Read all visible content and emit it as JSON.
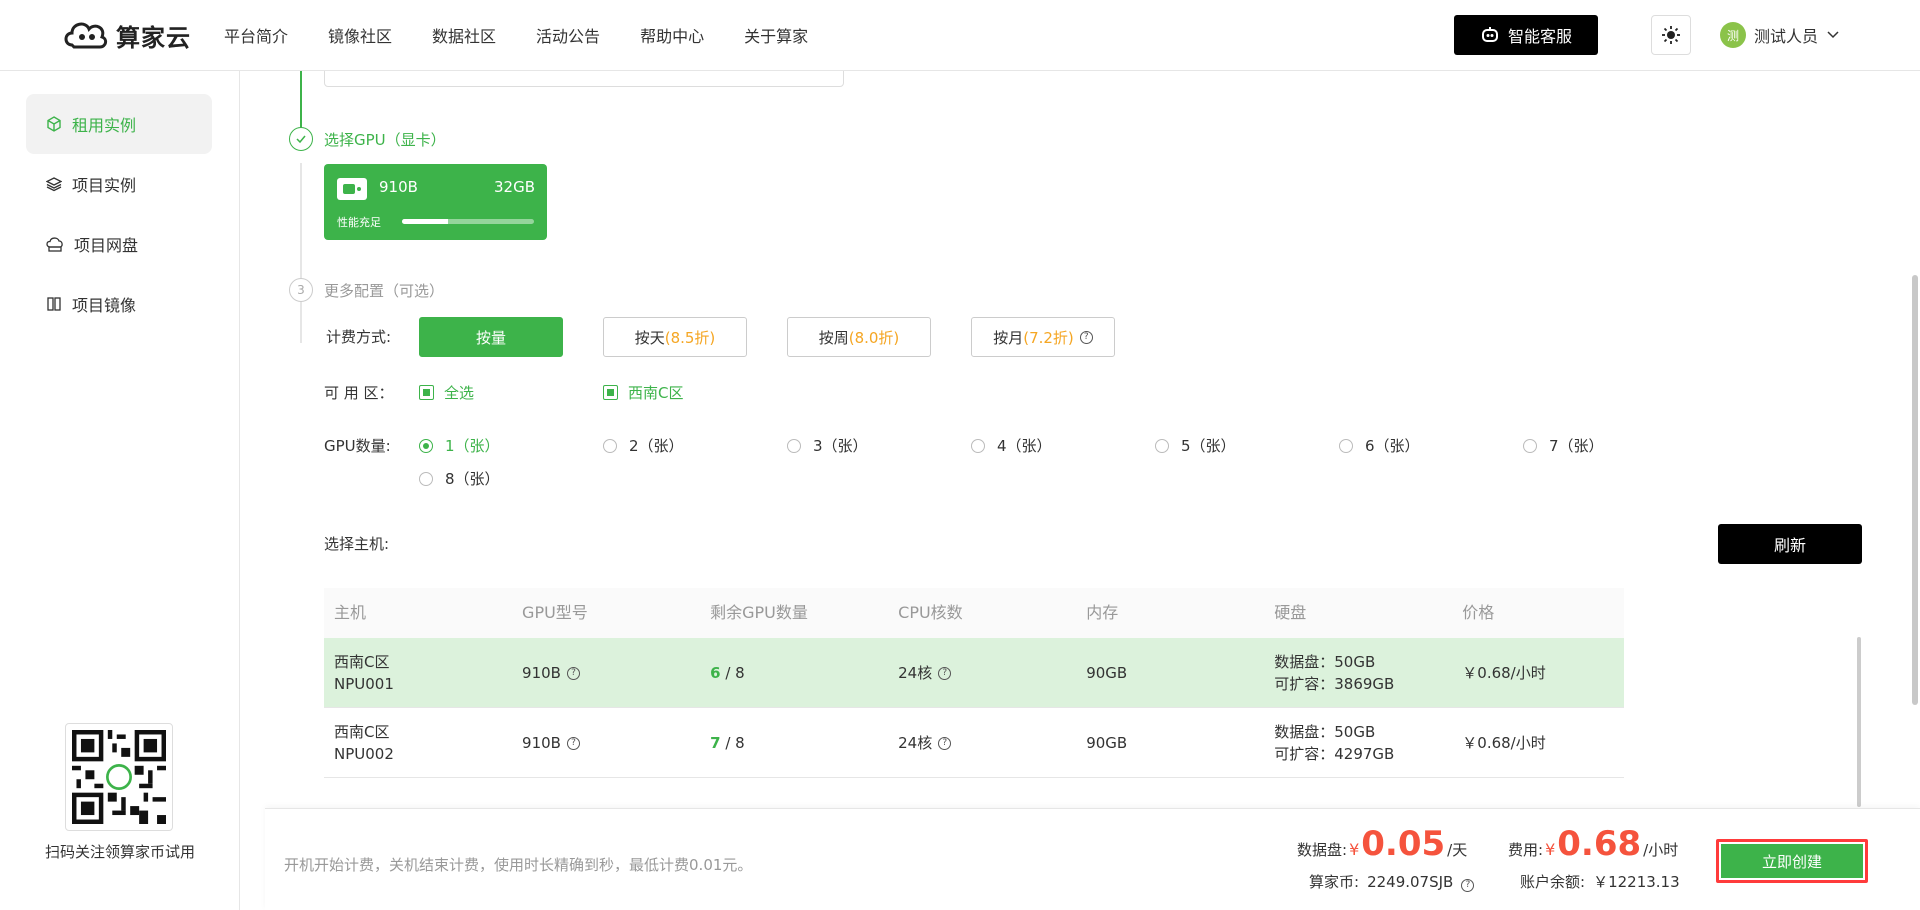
{
  "header": {
    "logo_text": "算家云",
    "nav": [
      "平台简介",
      "镜像社区",
      "数据社区",
      "活动公告",
      "帮助中心",
      "关于算家"
    ],
    "support_label": "智能客服",
    "user_avatar": "测",
    "user_name": "测试人员"
  },
  "sidebar": {
    "items": [
      {
        "label": "租用实例",
        "icon": "cube-icon"
      },
      {
        "label": "项目实例",
        "icon": "layers-icon"
      },
      {
        "label": "项目网盘",
        "icon": "cloud-disk-icon"
      },
      {
        "label": "项目镜像",
        "icon": "image-icon"
      }
    ],
    "qr_caption": "扫码关注领算家币试用"
  },
  "steps": {
    "gpu_title": "选择GPU（显卡）",
    "more_number": "3",
    "more_title": "更多配置（可选）"
  },
  "gpu_card": {
    "model": "910B",
    "memory": "32GB",
    "perf_label": "性能充足",
    "perf_fraction": 0.35
  },
  "billing": {
    "label": "计费方式:",
    "options": [
      {
        "main": "按量",
        "discount": ""
      },
      {
        "main": "按天",
        "discount": "(8.5折)"
      },
      {
        "main": "按周",
        "discount": "(8.0折)"
      },
      {
        "main": "按月",
        "discount": "(7.2折)"
      }
    ]
  },
  "zone": {
    "label": "可 用 区：",
    "options": [
      "全选",
      "西南C区"
    ]
  },
  "gpu_count": {
    "label": "GPU数量:",
    "options": [
      "1（张）",
      "2（张）",
      "3（张）",
      "4（张）",
      "5（张）",
      "6（张）",
      "7（张）",
      "8（张）"
    ],
    "selected": 0
  },
  "host": {
    "label": "选择主机:",
    "refresh_label": "刷新"
  },
  "table": {
    "headers": [
      "主机",
      "GPU型号",
      "剩余GPU数量",
      "CPU核数",
      "内存",
      "硬盘",
      "价格"
    ],
    "rows": [
      {
        "zone": "西南C区",
        "name": "NPU001",
        "gpu": "910B",
        "free": "6",
        "total": "/ 8",
        "cpu": "24核",
        "mem": "90GB",
        "disk1": "数据盘：50GB",
        "disk2": "可扩容：3869GB",
        "price": "￥0.68/小时"
      },
      {
        "zone": "西南C区",
        "name": "NPU002",
        "gpu": "910B",
        "free": "7",
        "total": "/ 8",
        "cpu": "24核",
        "mem": "90GB",
        "disk1": "数据盘：50GB",
        "disk2": "可扩容：4297GB",
        "price": "￥0.68/小时"
      }
    ]
  },
  "footer": {
    "note": "开机开始计费，关机结束计费，使用时长精确到秒，最低计费0.01元。",
    "disk_label": "数据盘:",
    "currency": "¥",
    "disk_price": "0.05",
    "disk_unit": "/天",
    "fee_label": "费用:",
    "fee_price": "0.68",
    "fee_unit": "/小时",
    "coin_label": "算家币:",
    "coin_value": "2249.07SJB",
    "balance_label": "账户余额:",
    "balance_value": "￥12213.13",
    "create_label": "立即创建"
  },
  "colors": {
    "accent": "#3db34a",
    "price": "#f5533d",
    "discount": "#f5a623"
  }
}
